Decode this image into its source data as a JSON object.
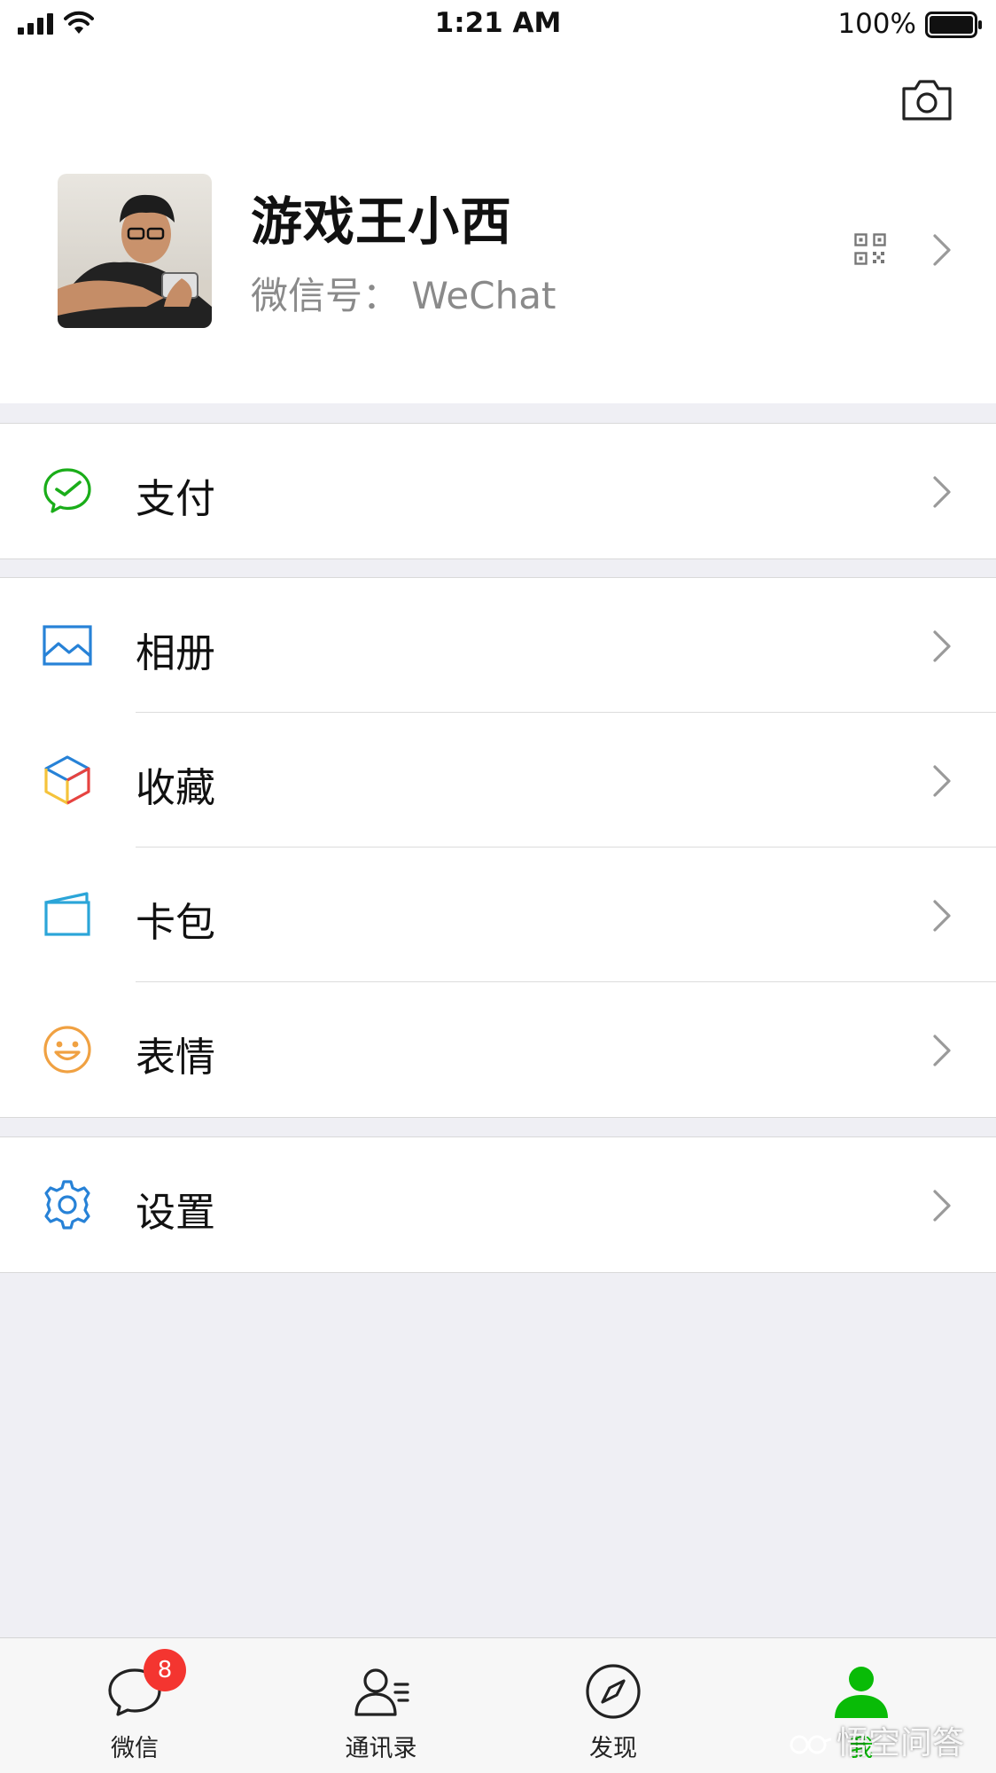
{
  "status_bar": {
    "time": "1:21 AM",
    "battery": "100%"
  },
  "profile": {
    "name": "游戏王小西",
    "wechat_id": "微信号： WeChat"
  },
  "menu": {
    "pay": "支付",
    "album": "相册",
    "favorites": "收藏",
    "cards": "卡包",
    "stickers": "表情",
    "settings": "设置"
  },
  "tabs": [
    {
      "label": "微信",
      "badge": "8"
    },
    {
      "label": "通讯录"
    },
    {
      "label": "发现"
    },
    {
      "label": "我"
    }
  ],
  "watermark": "悟空问答",
  "colors": {
    "accent_green": "#09bb07",
    "badge_red": "#f43530",
    "pay_icon": "#1aad19",
    "album_icon": "#2782d7",
    "settings_icon": "#2782d7",
    "stickers_icon": "#f0a142"
  }
}
